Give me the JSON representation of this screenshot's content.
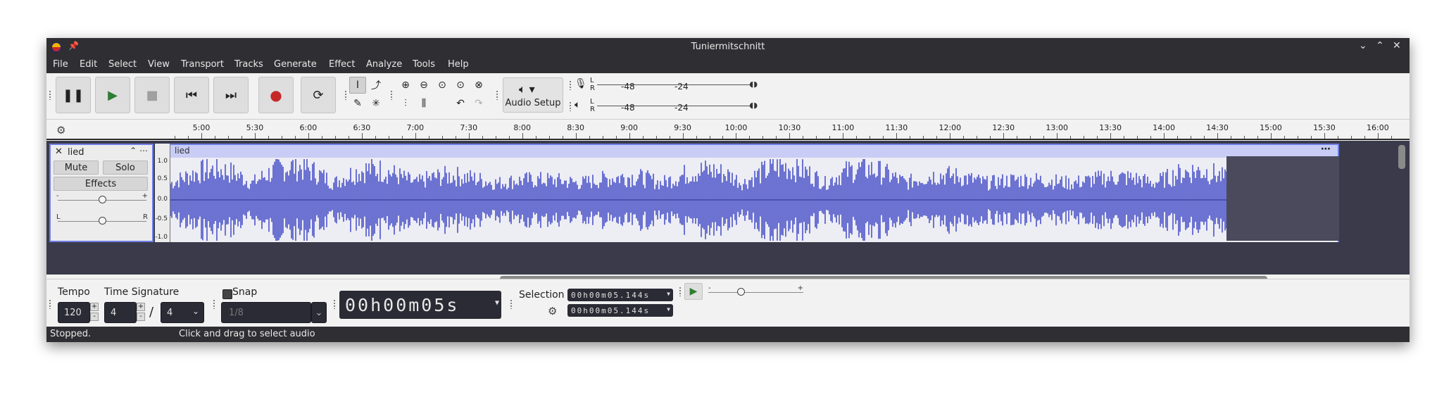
{
  "window": {
    "title": "Tuniermitschnitt"
  },
  "menu": [
    "File",
    "Edit",
    "Select",
    "View",
    "Transport",
    "Tracks",
    "Generate",
    "Effect",
    "Analyze",
    "Tools",
    "Help"
  ],
  "toolbar": {
    "audio_setup_label": "Audio Setup"
  },
  "meters": {
    "record": {
      "l": "L",
      "r": "R",
      "tick1": "-48",
      "tick2": "-24"
    },
    "play": {
      "l": "L",
      "r": "R",
      "tick1": "-48",
      "tick2": "-24"
    }
  },
  "ruler": {
    "labels": [
      "5:00",
      "5:30",
      "6:00",
      "6:30",
      "7:00",
      "7:30",
      "8:00",
      "8:30",
      "9:00",
      "9:30",
      "10:00",
      "10:30",
      "11:00",
      "11:30",
      "12:00",
      "12:30",
      "13:00",
      "13:30",
      "14:00",
      "14:30",
      "15:00",
      "15:30",
      "16:00"
    ]
  },
  "track": {
    "name": "lied",
    "clip_name": "lied",
    "mute_label": "Mute",
    "solo_label": "Solo",
    "effects_label": "Effects",
    "gain_min": "-",
    "gain_max": "+",
    "pan_left": "L",
    "pan_right": "R",
    "gain_level": 0.5,
    "pan_level": 0.5,
    "vruler": [
      "1.0",
      "0.5",
      "0.0",
      "-0.5",
      "-1.0"
    ],
    "wave_color": "#4b54c8"
  },
  "bottom": {
    "tempo_label": "Tempo",
    "tempo_value": "120",
    "timesig_label": "Time Signature",
    "timesig_num": "4",
    "timesig_slash": "/",
    "timesig_den": "4",
    "snap_label": "Snap",
    "snap_value": "1/8",
    "time_display": "00h00m05s",
    "selection_label": "Selection",
    "selection_start": "00h00m05.144s",
    "selection_end": "00h00m05.144s",
    "speed_min": "-",
    "speed_max": "+",
    "speed_level": 0.33
  },
  "status": {
    "state": "Stopped.",
    "hint": "Click and drag to select audio"
  }
}
